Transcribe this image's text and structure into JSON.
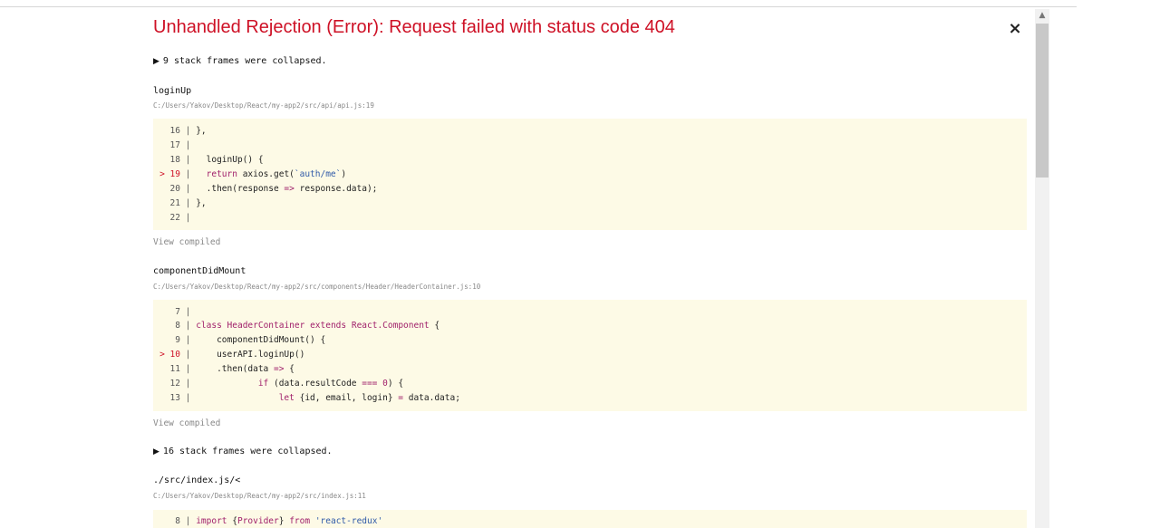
{
  "error_title": "Unhandled Rejection (Error): Request failed with status code 404",
  "close_label": "×",
  "collapsed_1": "9 stack frames were collapsed.",
  "frame1": {
    "function": "loginUp",
    "path": "C:/Users/Yakov/Desktop/React/my-app2/src/api/api.js:19",
    "view": "View compiled"
  },
  "frame2": {
    "function": "componentDidMount",
    "path": "C:/Users/Yakov/Desktop/React/my-app2/src/components/Header/HeaderContainer.js:10",
    "view": "View compiled"
  },
  "collapsed_2": "16 stack frames were collapsed.",
  "frame3": {
    "function": "./src/index.js/<",
    "path": "C:/Users/Yakov/Desktop/React/my-app2/src/index.js:11"
  },
  "icons": {
    "collapse": "triangle-right-icon",
    "close": "close-icon",
    "scroll_up": "chevron-up-icon"
  },
  "colors": {
    "title": "#ce1126",
    "code_bg": "#fdfae6",
    "keyword": "#a01f6a",
    "string": "#2f5aa8"
  }
}
